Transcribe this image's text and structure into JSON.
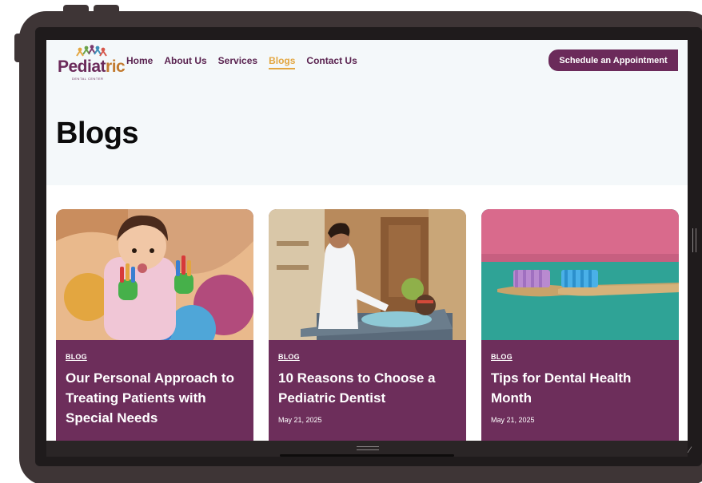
{
  "site": {
    "logo_main": "Pediat",
    "logo_tail": "ric",
    "logo_sub": "DENTAL CENTER"
  },
  "nav": {
    "items": [
      {
        "label": "Home",
        "active": false
      },
      {
        "label": "About Us",
        "active": false
      },
      {
        "label": "Services",
        "active": false
      },
      {
        "label": "Blogs",
        "active": true
      },
      {
        "label": "Contact Us",
        "active": false
      }
    ],
    "cta_label": "Schedule an Appointment"
  },
  "page": {
    "title": "Blogs"
  },
  "posts": [
    {
      "tag": "BLOG",
      "title": "Our Personal Approach to Treating Patients with Special Needs",
      "date": "",
      "image_icon": "child-painted-hands-image"
    },
    {
      "tag": "BLOG",
      "title": "10 Reasons to Choose a Pediatric Dentist",
      "date": "May 21, 2025",
      "image_icon": "dentist-with-child-image"
    },
    {
      "tag": "BLOG",
      "title": "Tips for Dental Health Month",
      "date": "May 21, 2025",
      "image_icon": "toothbrushes-image"
    }
  ],
  "colors": {
    "brand_purple": "#6b2a5a",
    "card_purple": "#6d2e5b",
    "active_nav": "#e3a640",
    "header_bg": "#f4f8fa",
    "frame": "#3e3536"
  }
}
